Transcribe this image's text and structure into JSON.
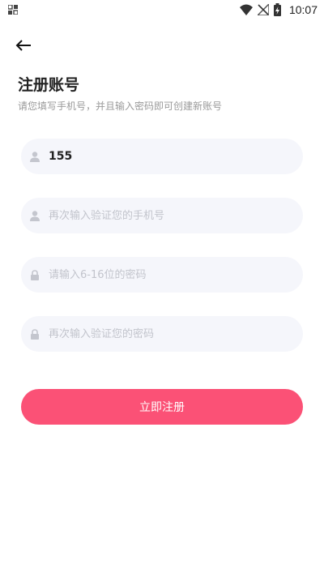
{
  "status_bar": {
    "time": "10:07",
    "icons": [
      "qr-grid-icon",
      "wifi-icon",
      "no-signal-icon",
      "battery-charging-icon"
    ]
  },
  "header": {
    "back_icon": "arrow-left-icon",
    "title": "注册账号",
    "subtitle": "请您填写手机号，并且输入密码即可创建新账号"
  },
  "form": {
    "phone": {
      "value": "155",
      "placeholder": "",
      "icon": "user-icon"
    },
    "phone_confirm": {
      "value": "",
      "placeholder": "再次输入验证您的手机号",
      "icon": "user-icon"
    },
    "password": {
      "value": "",
      "placeholder": "请输入6-16位的密码",
      "icon": "lock-icon"
    },
    "password_confirm": {
      "value": "",
      "placeholder": "再次输入验证您的密码",
      "icon": "lock-icon"
    }
  },
  "submit": {
    "label": "立即注册"
  },
  "colors": {
    "accent": "#fb5176",
    "field_bg": "#f5f6fb",
    "placeholder": "#c2c4cc",
    "subtitle": "#9a9a9a"
  }
}
